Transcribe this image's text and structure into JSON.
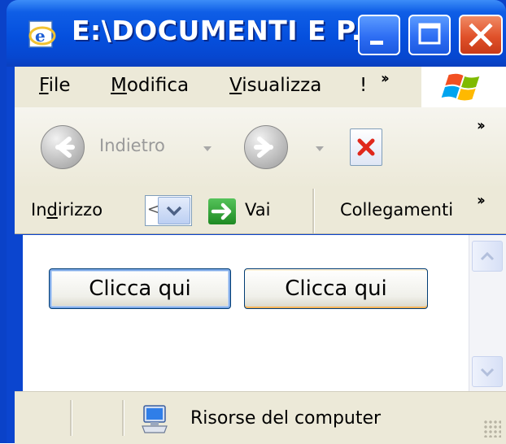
{
  "window": {
    "title": "E:\\DOCUMENTI E P..."
  },
  "menu": {
    "file": "ile",
    "file_mnemonic": "F",
    "edit": "odifica",
    "edit_mnemonic": "M",
    "view": "isualizza",
    "view_mnemonic": "V",
    "partial": "!"
  },
  "toolbar": {
    "back_label": "Indietro"
  },
  "address": {
    "label_pre": "In",
    "label_mnemonic": "d",
    "label_post": "irizzo",
    "go_label": "Vai",
    "links_label": "Collegamenti",
    "field_partial": "<"
  },
  "page": {
    "button1": "Clicca qui",
    "button2": "Clicca qui"
  },
  "status": {
    "zone": "Risorse del computer"
  }
}
